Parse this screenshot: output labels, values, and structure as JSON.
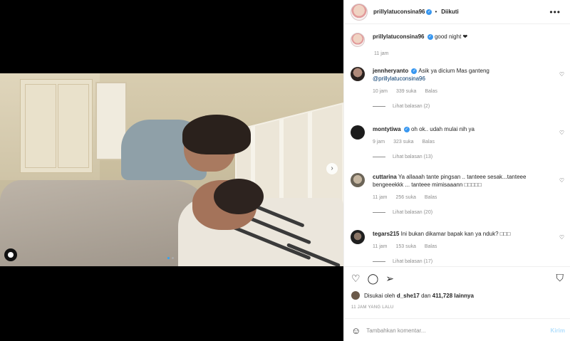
{
  "post": {
    "username": "prillylatuconsina96",
    "follow_status": "Diikuti",
    "more": "•••",
    "caption": "good night ❤",
    "caption_time": "11 jam"
  },
  "media": {
    "next_arrow": "›",
    "carousel_index": 1,
    "carousel_total": 2
  },
  "comments": [
    {
      "user": "jennheryanto",
      "verified": true,
      "text": "Asik ya dicium Mas ganteng",
      "mention": "@prillylatuconsina96",
      "time": "10 jam",
      "likes": "339 suka",
      "reply": "Balas",
      "view_replies": "Lihat balasan (2)"
    },
    {
      "user": "montytiwa",
      "verified": true,
      "text": "oh ok.. udah mulai nih ya",
      "mention": "",
      "time": "9 jam",
      "likes": "323 suka",
      "reply": "Balas",
      "view_replies": "Lihat balasan (13)"
    },
    {
      "user": "cuttarina",
      "verified": false,
      "text": "Ya allaaah tante pingsan .. tanteee sesak...tanteee bengeeekkk ... tanteee mimisaaann □□□□□",
      "mention": "",
      "time": "11 jam",
      "likes": "256 suka",
      "reply": "Balas",
      "view_replies": "Lihat balasan (20)"
    },
    {
      "user": "tegars215",
      "verified": false,
      "text": "Ini bukan dikamar bapak kan ya nduk? □□□",
      "mention": "",
      "time": "11 jam",
      "likes": "153 suka",
      "reply": "Balas",
      "view_replies": "Lihat balasan (17)"
    }
  ],
  "actions": {
    "liked_by_prefix": "Disukai oleh",
    "liked_by_user": "d_she17",
    "liked_by_join": "dan",
    "liked_by_count": "411,728 lainnya",
    "posted_time": "11 JAM YANG LALU"
  },
  "add_comment": {
    "placeholder": "Tambahkan komentar...",
    "send_label": "Kirim"
  },
  "icons": {
    "like": "heart-icon",
    "comment": "comment-icon",
    "share": "share-icon",
    "save": "bookmark-icon",
    "emoji": "emoji-icon"
  },
  "colors": {
    "verified": "#3897f0",
    "send_disabled": "#b2dffc",
    "muted": "#8e8e8e"
  }
}
